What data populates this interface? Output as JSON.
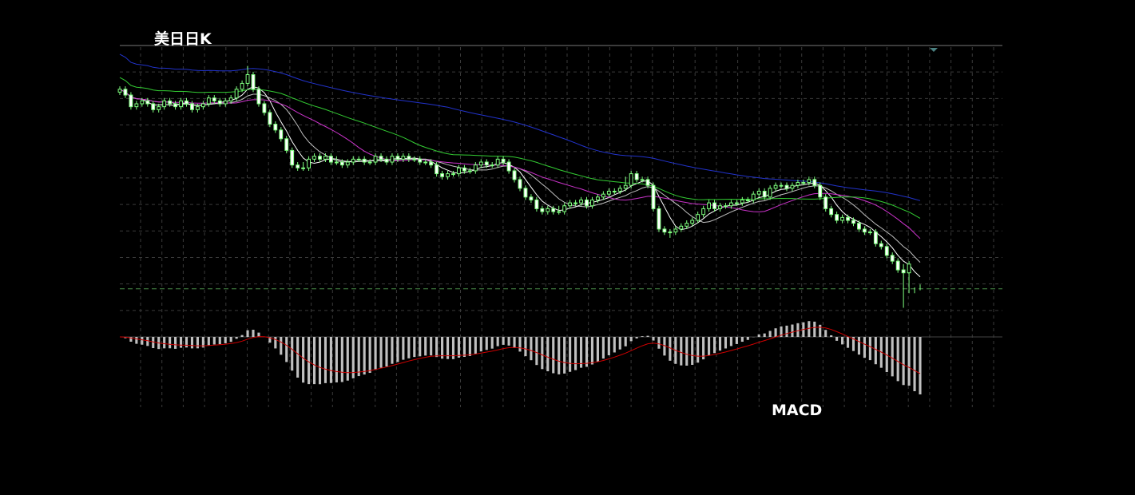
{
  "chart_data": [
    {
      "type": "candlestick",
      "title": "美日日K",
      "grid": true,
      "ylim": [
        0,
        100
      ],
      "current_price_line": 16.5,
      "colors": {
        "up": "#7fff7f",
        "down": "#7fff7f",
        "up_body": "#000000",
        "down_body": "#ffffff",
        "grid": "#3a3a3a",
        "current_price": "#4a8f4a"
      },
      "x": [
        0,
        1,
        2,
        3,
        4,
        5,
        6,
        7,
        8,
        9,
        10,
        11,
        12,
        13,
        14,
        15,
        16,
        17,
        18,
        19,
        20,
        21,
        22,
        23,
        24,
        25,
        26,
        27,
        28,
        29,
        30,
        31,
        32,
        33,
        34,
        35,
        36,
        37,
        38,
        39,
        40,
        41,
        42,
        43,
        44,
        45,
        46,
        47,
        48,
        49,
        50,
        51,
        52,
        53,
        54,
        55,
        56,
        57,
        58,
        59,
        60,
        61,
        62,
        63,
        64,
        65,
        66,
        67,
        68,
        69,
        70,
        71,
        72,
        73,
        74,
        75,
        76,
        77,
        78,
        79,
        80,
        81,
        82,
        83,
        84,
        85,
        86,
        87,
        88,
        89,
        90,
        91,
        92,
        93,
        94,
        95,
        96,
        97,
        98,
        99,
        100,
        101,
        102,
        103,
        104,
        105,
        106,
        107,
        108,
        109,
        110,
        111,
        112,
        113,
        114,
        115,
        116,
        117,
        118,
        119,
        120,
        121,
        122,
        123,
        124,
        125,
        126,
        127,
        128,
        129,
        130,
        131,
        132,
        133,
        134,
        135,
        136,
        137,
        138,
        139,
        140,
        141,
        142,
        143,
        144,
        145,
        146,
        147,
        148,
        149,
        150,
        151,
        152,
        153,
        154,
        155,
        156,
        157,
        158,
        159,
        160,
        161,
        162,
        163,
        164,
        165,
        166,
        167,
        168,
        169,
        170,
        171,
        172,
        173,
        174
      ],
      "open": [
        84,
        85,
        83,
        79,
        80,
        81,
        80,
        78,
        79,
        81,
        80,
        79,
        81,
        80,
        78,
        79,
        80,
        82,
        81,
        80,
        81,
        82,
        85,
        87,
        90,
        85,
        80,
        77,
        73,
        71,
        68,
        64,
        59,
        58,
        58,
        61,
        62,
        61,
        62,
        60,
        60,
        59,
        60,
        61,
        61,
        60,
        60,
        62,
        61,
        60,
        62,
        61,
        62,
        61,
        61,
        60,
        60,
        59,
        56,
        55,
        56,
        56,
        58,
        57,
        57,
        59,
        60,
        59,
        59,
        61,
        60,
        57,
        54,
        51,
        48,
        47,
        44,
        43,
        44,
        43,
        43,
        45,
        46,
        46,
        47,
        45,
        47,
        48,
        49,
        50,
        50,
        51,
        52,
        56,
        54,
        54,
        52,
        44,
        37,
        36,
        36,
        37,
        38,
        39,
        40,
        42,
        44,
        46,
        44,
        45,
        45,
        46,
        46,
        47,
        47,
        49,
        50,
        48,
        51,
        52,
        52,
        51,
        52,
        53,
        53,
        54,
        52,
        48,
        44,
        42,
        40,
        41,
        40,
        39,
        37,
        36,
        36,
        32,
        31,
        28,
        26,
        23,
        22
      ],
      "close": [
        85,
        83,
        79,
        80,
        81,
        80,
        78,
        79,
        81,
        80,
        79,
        81,
        80,
        78,
        79,
        80,
        82,
        81,
        80,
        81,
        82,
        85,
        87,
        90,
        85,
        80,
        77,
        73,
        71,
        68,
        64,
        59,
        58,
        58,
        61,
        62,
        61,
        62,
        60,
        60,
        59,
        60,
        61,
        61,
        60,
        60,
        62,
        61,
        60,
        62,
        61,
        62,
        61,
        61,
        60,
        60,
        59,
        56,
        55,
        56,
        56,
        58,
        57,
        57,
        59,
        60,
        59,
        59,
        61,
        60,
        57,
        54,
        51,
        48,
        47,
        44,
        43,
        44,
        43,
        43,
        45,
        46,
        46,
        47,
        45,
        47,
        48,
        49,
        50,
        50,
        51,
        52,
        56,
        54,
        54,
        52,
        44,
        37,
        36,
        36,
        37,
        38,
        39,
        40,
        42,
        44,
        46,
        44,
        45,
        45,
        46,
        46,
        47,
        47,
        49,
        50,
        48,
        51,
        52,
        52,
        51,
        52,
        53,
        53,
        54,
        52,
        48,
        44,
        42,
        40,
        41,
        40,
        39,
        37,
        36,
        36,
        32,
        31,
        28,
        26,
        23,
        22,
        25,
        16,
        17
      ],
      "high": [
        86,
        86,
        84,
        81,
        82,
        82,
        81,
        80,
        82,
        82,
        81,
        82,
        82,
        81,
        80,
        81,
        83,
        83,
        82,
        82,
        83,
        86,
        88,
        93,
        91,
        86,
        81,
        78,
        74,
        72,
        69,
        65,
        60,
        60,
        62,
        63,
        63,
        63,
        63,
        62,
        61,
        61,
        62,
        62,
        62,
        61,
        63,
        63,
        62,
        63,
        63,
        63,
        63,
        62,
        62,
        61,
        61,
        60,
        57,
        57,
        57,
        59,
        59,
        58,
        60,
        61,
        61,
        60,
        62,
        62,
        61,
        58,
        55,
        52,
        49,
        48,
        45,
        45,
        45,
        45,
        46,
        47,
        47,
        48,
        48,
        48,
        49,
        50,
        51,
        51,
        52,
        55,
        57,
        57,
        55,
        55,
        53,
        45,
        38,
        37,
        38,
        39,
        40,
        41,
        43,
        45,
        47,
        47,
        46,
        46,
        47,
        47,
        48,
        48,
        50,
        51,
        51,
        52,
        53,
        53,
        53,
        53,
        54,
        54,
        55,
        55,
        53,
        49,
        45,
        43,
        42,
        42,
        41,
        40,
        38,
        37,
        37,
        33,
        32,
        29,
        27,
        25,
        26,
        17,
        18
      ],
      "low": [
        83,
        82,
        78,
        78,
        79,
        79,
        77,
        77,
        78,
        79,
        78,
        78,
        79,
        77,
        77,
        78,
        79,
        80,
        79,
        79,
        80,
        81,
        84,
        86,
        84,
        79,
        76,
        72,
        70,
        67,
        63,
        58,
        57,
        57,
        57,
        60,
        60,
        60,
        59,
        59,
        58,
        58,
        59,
        60,
        59,
        59,
        59,
        60,
        59,
        59,
        60,
        60,
        60,
        60,
        59,
        59,
        58,
        55,
        54,
        54,
        55,
        55,
        56,
        56,
        56,
        58,
        58,
        58,
        58,
        59,
        56,
        53,
        50,
        47,
        46,
        43,
        42,
        42,
        42,
        42,
        42,
        44,
        45,
        45,
        44,
        44,
        46,
        47,
        48,
        49,
        49,
        50,
        51,
        53,
        53,
        51,
        43,
        36,
        35,
        34,
        35,
        36,
        37,
        38,
        39,
        41,
        43,
        43,
        43,
        44,
        44,
        45,
        45,
        46,
        46,
        48,
        47,
        47,
        50,
        51,
        50,
        50,
        51,
        52,
        52,
        51,
        47,
        43,
        41,
        39,
        39,
        39,
        38,
        36,
        35,
        35,
        31,
        30,
        27,
        25,
        22,
        10,
        15,
        15,
        16
      ]
    },
    {
      "type": "bar",
      "title": "MACD",
      "grid": true,
      "colors": {
        "histogram": "#c0c0c0",
        "signal": "#cc0000"
      }
    }
  ]
}
